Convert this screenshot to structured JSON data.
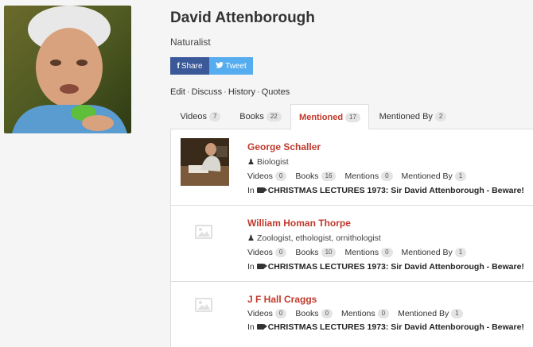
{
  "profile": {
    "name": "David Attenborough",
    "subtitle": "Naturalist",
    "share": {
      "facebook_label": "Share",
      "twitter_label": "Tweet"
    },
    "links": [
      "Edit",
      "Discuss",
      "History",
      "Quotes"
    ]
  },
  "tabs": [
    {
      "label": "Videos",
      "count": "7"
    },
    {
      "label": "Books",
      "count": "22"
    },
    {
      "label": "Mentioned",
      "count": "17"
    },
    {
      "label": "Mentioned By",
      "count": "2"
    }
  ],
  "mentions": [
    {
      "name": "George Schaller",
      "occupation": "Biologist",
      "videos": "0",
      "books": "16",
      "mentions": "0",
      "mentioned_by": "1",
      "in_prefix": "In",
      "source": "CHRISTMAS LECTURES 1973: Sir David Attenborough - Beware!"
    },
    {
      "name": "William Homan Thorpe",
      "occupation": "Zoologist, ethologist, ornithologist",
      "videos": "0",
      "books": "10",
      "mentions": "0",
      "mentioned_by": "1",
      "in_prefix": "In",
      "source": "CHRISTMAS LECTURES 1973: Sir David Attenborough - Beware!"
    },
    {
      "name": "J F Hall Craggs",
      "videos": "0",
      "books": "0",
      "mentions": "0",
      "mentioned_by": "1",
      "in_prefix": "In",
      "source": "CHRISTMAS LECTURES 1973: Sir David Attenborough - Beware!"
    }
  ],
  "stat_labels": {
    "videos": "Videos",
    "books": "Books",
    "mentions": "Mentions",
    "mentioned_by": "Mentioned By"
  },
  "colors": {
    "accent": "#c0392b",
    "facebook": "#3b5998",
    "twitter": "#55acee"
  }
}
